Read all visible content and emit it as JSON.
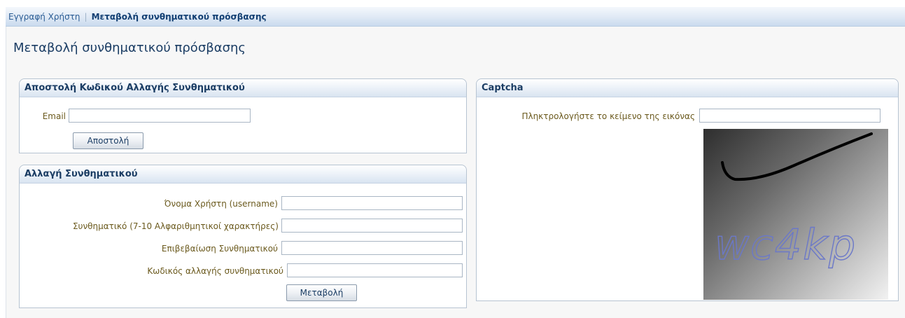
{
  "breadcrumb": {
    "items": [
      {
        "label": "Εγγραφή Χρήστη"
      },
      {
        "label": "Μεταβολή συνθηματικού πρόσβασης"
      }
    ],
    "separator": "|"
  },
  "page": {
    "title": "Μεταβολή συνθηματικού πρόσβασης"
  },
  "send_code_panel": {
    "header": "Αποστολή Κωδικού Αλλαγής Συνθηματικού",
    "email_label": "Email",
    "email_value": "",
    "send_button": "Αποστολή"
  },
  "change_password_panel": {
    "header": "Αλλαγή Συνθηματικού",
    "fields": [
      {
        "label": "Όνομα Χρήστη (username)",
        "value": ""
      },
      {
        "label": "Συνθηματικό (7-10 Αλφαριθμητικοί χαρακτήρες)",
        "value": ""
      },
      {
        "label": "Επιβεβαίωση Συνθηματικού",
        "value": ""
      },
      {
        "label": "Κωδικός αλλαγής συνθηματικού",
        "value": ""
      }
    ],
    "submit_button": "Μεταβολή"
  },
  "captcha_panel": {
    "header": "Captcha",
    "prompt_label": "Πληκτρολογήστε το κείμενο της εικόνας",
    "input_value": "",
    "captcha_text": "wc4kp"
  }
}
